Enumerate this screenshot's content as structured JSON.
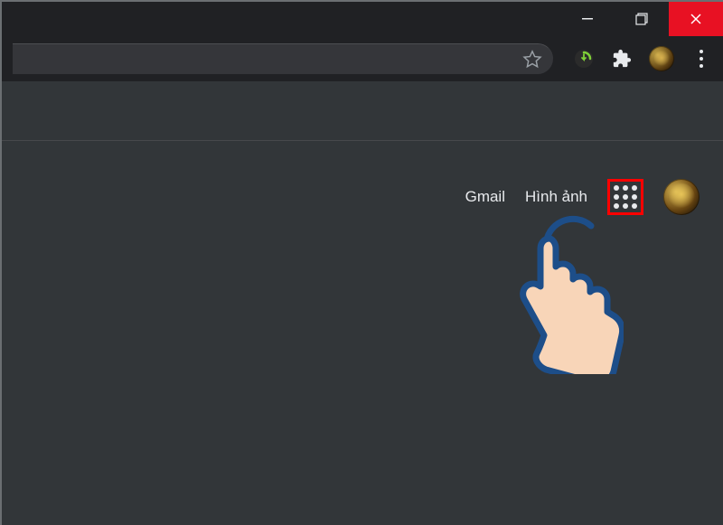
{
  "window": {
    "minimize_label": "Minimize",
    "maximize_label": "Restore",
    "close_label": "Close"
  },
  "toolbar": {
    "bookmark_label": "Bookmark",
    "extension1_label": "IDM",
    "extension2_label": "Extensions",
    "profile_label": "Profile",
    "menu_label": "Menu"
  },
  "google_nav": {
    "gmail_label": "Gmail",
    "images_label": "Hình ảnh",
    "apps_label": "Google apps",
    "account_label": "Account"
  },
  "annotation": {
    "highlight_color": "#ff0000"
  }
}
